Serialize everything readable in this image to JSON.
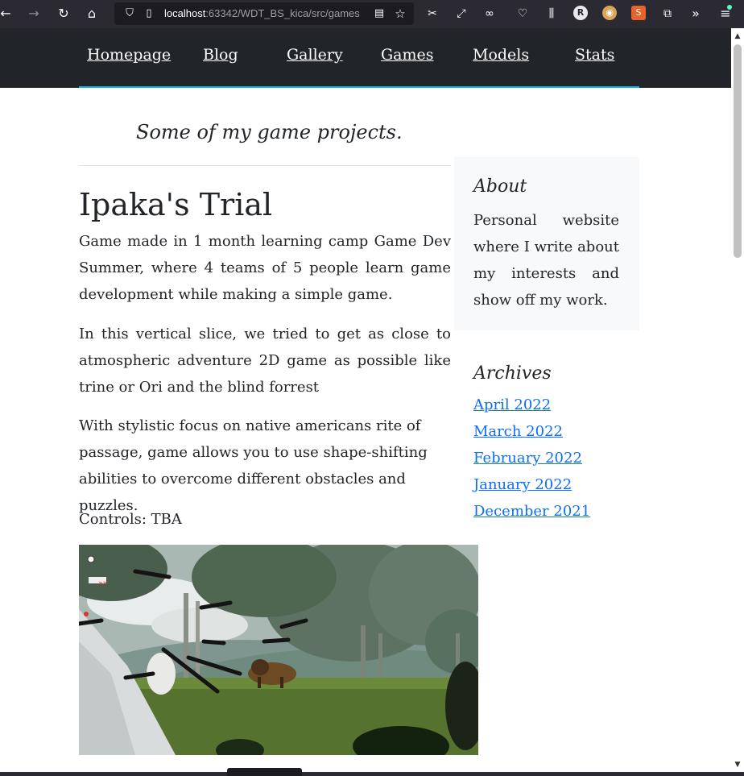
{
  "browser": {
    "url_host": "localhost",
    "url_rest": ":63342/WDT_BS_kica/src/games"
  },
  "nav": {
    "items": [
      {
        "label": "Homepage"
      },
      {
        "label": "Blog"
      },
      {
        "label": "Gallery"
      },
      {
        "label": "Games"
      },
      {
        "label": "Models"
      },
      {
        "label": "Stats"
      }
    ]
  },
  "page": {
    "tagline": "Some of my game projects."
  },
  "post": {
    "title": "Ipaka's Trial",
    "paragraphs": [
      "Game made in 1 month learning camp Game Dev Summer, where 4 teams of 5 people learn game development while making a simple game.",
      "In this vertical slice, we tried to get as close to atmospheric adventure 2D game as possible like trine or Ori and the blind forrest",
      "With stylistic focus on native americans rite of passage, game allows you to use shape-shifting abilities to overcome different obstacles and puzzles.",
      "Controls: TBA"
    ]
  },
  "sidebar": {
    "about_title": "About",
    "about_text": "Personal website where I write about my interests and show off my work.",
    "archives_title": "Archives",
    "archives": [
      {
        "label": "April 2022"
      },
      {
        "label": "March 2022"
      },
      {
        "label": "February 2022"
      },
      {
        "label": "January 2022"
      },
      {
        "label": "December 2021"
      }
    ]
  },
  "colors": {
    "nav_bg": "#212529",
    "accent": "#1aa6e0",
    "link": "#0d6efd",
    "sidebar_bg": "#f8f9fa"
  }
}
